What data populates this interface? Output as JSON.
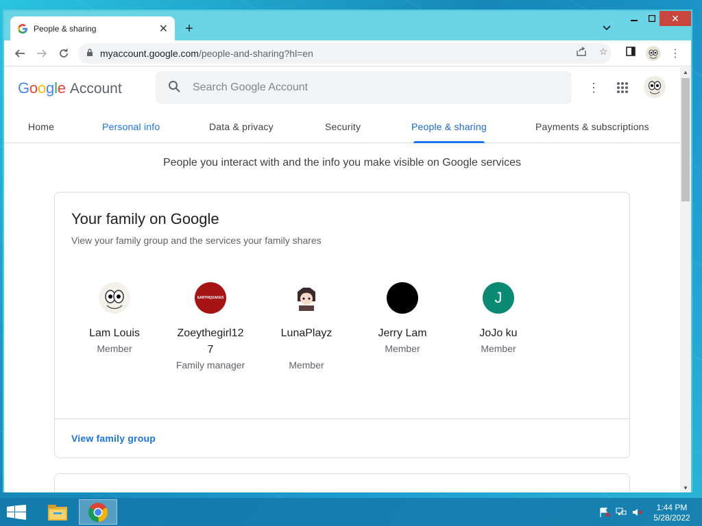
{
  "browser": {
    "tab_title": "People & sharing",
    "url_domain": "myaccount.google.com",
    "url_path": "/people-and-sharing?hl=en"
  },
  "header": {
    "logo_text": "Google",
    "logo_suffix": "Account",
    "search_placeholder": "Search Google Account"
  },
  "nav": {
    "tabs": [
      {
        "label": "Home"
      },
      {
        "label": "Personal info"
      },
      {
        "label": "Data & privacy"
      },
      {
        "label": "Security"
      },
      {
        "label": "People & sharing"
      },
      {
        "label": "Payments & subscriptions"
      }
    ],
    "active": "People & sharing"
  },
  "intro": "People you interact with and the info you make visible on Google services",
  "family": {
    "title": "Your family on Google",
    "subtitle": "View your family group and the services your family shares",
    "members": [
      {
        "name": "Lam Louis",
        "role": "Member"
      },
      {
        "name": "Zoeythegirl12\n7",
        "role": "Family manager",
        "avatar_text": "EARTHQUAKES"
      },
      {
        "name": "LunaPlayz",
        "role": "Member"
      },
      {
        "name": "Jerry Lam",
        "role": "Member"
      },
      {
        "name": "JoJo ku",
        "role": "Member",
        "avatar_letter": "J"
      }
    ],
    "link": "View family group"
  },
  "taskbar": {
    "time": "1:44 PM",
    "date": "5/28/2022"
  },
  "colors": {
    "accent": "#1a73e8",
    "jojo_avatar": "#0b8a73",
    "zoey_avatar": "#a81414"
  }
}
